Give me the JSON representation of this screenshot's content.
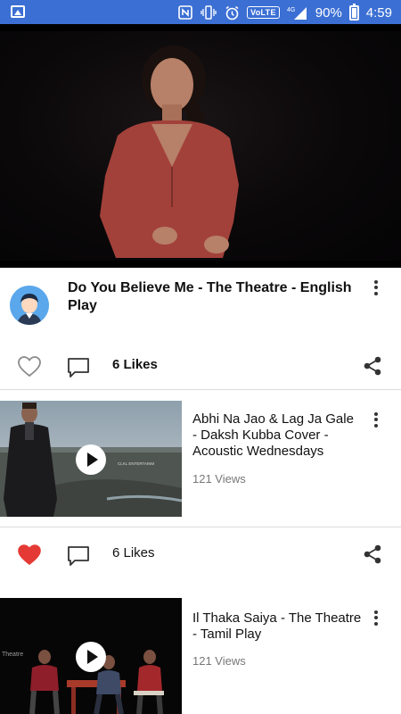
{
  "status_bar": {
    "volte": "VoLTE",
    "network": "4G",
    "battery": "90%",
    "time": "4:59"
  },
  "main_video": {
    "title": "Do You Believe Me - The Theatre - English Play",
    "likes": "6 Likes",
    "liked": false
  },
  "feed": [
    {
      "title": "Abhi Na Jao & Lag Ja Gale - Daksh Kubba Cover - Acoustic Wednesdays",
      "views": "121 Views",
      "watermark": "CLKL ENTERTAINM",
      "likes": "6 Likes",
      "liked": true
    },
    {
      "title": "Il Thaka Saiya - The Theatre - Tamil Play",
      "views": "121 Views",
      "watermark": "Theatre"
    }
  ],
  "colors": {
    "status_bar": "#3b6fd4",
    "heart_active": "#e53935",
    "avatar_bg": "#5aa7ec"
  }
}
